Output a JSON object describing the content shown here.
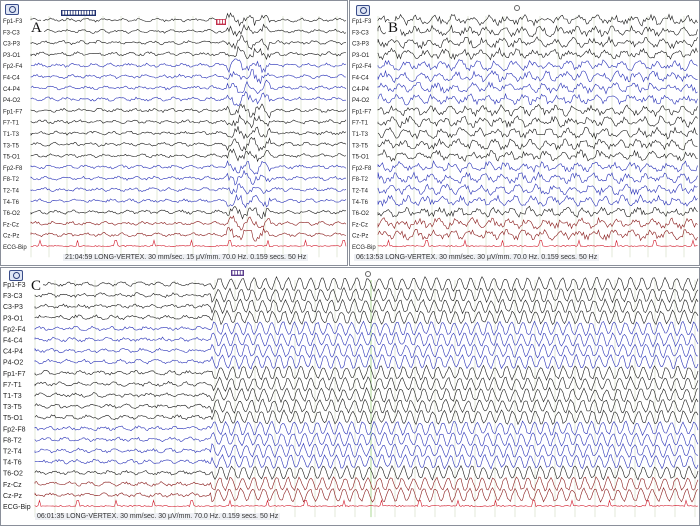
{
  "panels": {
    "a": {
      "letter": "A",
      "status": "21:04:59 LONG-VERTEX. 30 mm/sec. 15 μV/mm. 70.0 Hz. 0.159 secs. 50 Hz",
      "channels": [
        "Fp1-F3",
        "F3-C3",
        "C3-P3",
        "P3-O1",
        "Fp2-F4",
        "F4-C4",
        "C4-P4",
        "P4-O2",
        "Fp1-F7",
        "F7-T1",
        "T1-T3",
        "T3-T5",
        "T5-O1",
        "Fp2-F8",
        "F8-T2",
        "T2-T4",
        "T4-T6",
        "T6-O2",
        "Fz-Cz",
        "Cz-Pz",
        "ECG-Bip"
      ]
    },
    "b": {
      "letter": "B",
      "status": "06:13:53 LONG-VERTEX. 30 mm/sec. 30 μV/mm. 70.0 Hz. 0.159 secs. 50 Hz",
      "channels": [
        "Fp1-F3",
        "F3-C3",
        "C3-P3",
        "P3-O1",
        "Fp2-F4",
        "F4-C4",
        "C4-P4",
        "P4-O2",
        "Fp1-F7",
        "F7-T1",
        "T1-T3",
        "T3-T5",
        "T5-O1",
        "Fp2-F8",
        "F8-T2",
        "T2-T4",
        "T4-T6",
        "T6-O2",
        "Fz-Cz",
        "Cz-Pz",
        "ECG-Bip"
      ]
    },
    "c": {
      "letter": "C",
      "status": "06:01:35 LONG-VERTEX. 30 mm/sec. 30 μV/mm. 70.0 Hz. 0.159 secs. 50 Hz",
      "channels": [
        "Fp1-F3",
        "F3-C3",
        "C3-P3",
        "P3-O1",
        "Fp2-F4",
        "F4-C4",
        "C4-P4",
        "P4-O2",
        "Fp1-F7",
        "F7-T1",
        "T1-T3",
        "T3-T5",
        "T5-O1",
        "Fp2-F8",
        "F8-T2",
        "T2-T4",
        "T4-T6",
        "T6-O2",
        "Fz-Cz",
        "Cz-Pz",
        "ECG-Bip"
      ]
    }
  },
  "colors": {
    "black_trace": "#1a1a1a",
    "blue_trace": "#2a33b8",
    "red_trace": "#8a1c1c",
    "ecg_trace": "#d21d2e",
    "grid": "#b9c7a0",
    "marker": "#9ad17a"
  }
}
